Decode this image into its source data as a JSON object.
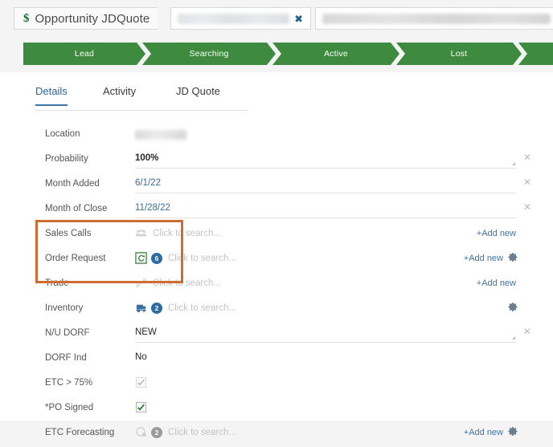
{
  "header": {
    "dollar_icon": "dollar-icon",
    "title": "Opportunity JDQuote",
    "field_one_value": "",
    "field_one_clear": "✖",
    "field_two_value": ""
  },
  "stages": {
    "items": [
      {
        "label": "Lead"
      },
      {
        "label": "Searching"
      },
      {
        "label": "Active"
      },
      {
        "label": "Lost"
      },
      {
        "label": ""
      }
    ],
    "color": "#3e8b40"
  },
  "tabs": [
    {
      "label": "Details",
      "active": true
    },
    {
      "label": "Activity",
      "active": false
    },
    {
      "label": "JD Quote",
      "active": false
    }
  ],
  "placeholder": "Click to search...",
  "add_new_label": "+Add new",
  "clear_icon": "✕",
  "colors": {
    "accent_blue": "#3d74a3",
    "stage_green": "#3e8b40",
    "highlight_orange": "#cf6c33",
    "badge_blue": "#2d6ca2"
  },
  "fields": [
    {
      "label": "Location",
      "value": ""
    },
    {
      "label": "Probability",
      "value": "100%"
    },
    {
      "label": "Month Added",
      "value": "6/1/22"
    },
    {
      "label": "Month of Close",
      "value": "11/28/22"
    },
    {
      "label": "Sales Calls",
      "value": ""
    },
    {
      "label": "Order Request",
      "value": "",
      "badge": "6"
    },
    {
      "label": "Trade",
      "value": ""
    },
    {
      "label": "Inventory",
      "value": "",
      "badge": "2"
    },
    {
      "label": "N/U DORF",
      "value": "NEW"
    },
    {
      "label": "DORF Ind",
      "value": "No"
    },
    {
      "label": "ETC > 75%",
      "value": ""
    },
    {
      "label": "*PO Signed",
      "value": ""
    },
    {
      "label": "ETC Forecasting",
      "value": "",
      "badge": "2"
    }
  ]
}
